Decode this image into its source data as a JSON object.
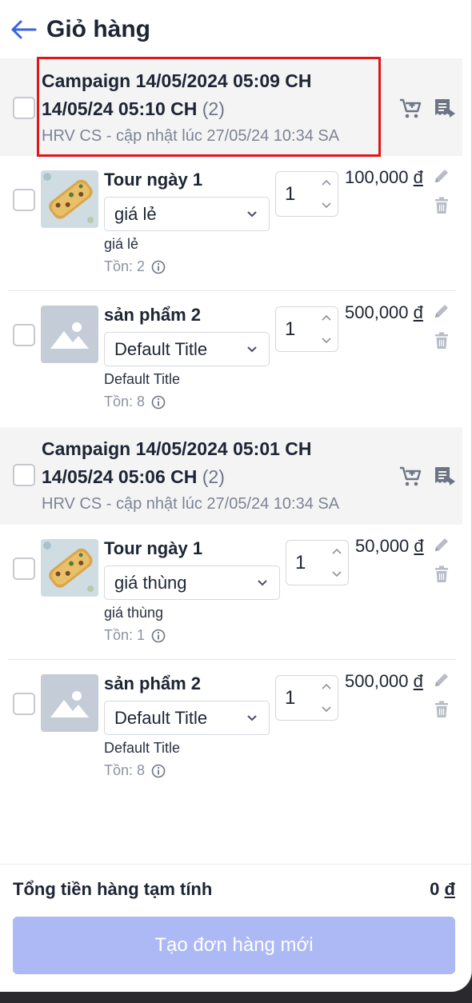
{
  "header": {
    "title": "Giỏ hàng"
  },
  "groups": [
    {
      "title_line1": "Campaign 14/05/2024 05:09 CH",
      "title_line2": "14/05/24 05:10 CH",
      "count": "(2)",
      "subtitle": "HRV CS - cập nhật lúc 27/05/24 10:34 SA",
      "items": [
        {
          "name": "Tour ngày 1",
          "variant_select": "giá lẻ",
          "variant_label": "giá lẻ",
          "stock": "Tồn: 2",
          "quantity": "1",
          "price": "100,000",
          "currency": "đ",
          "thumb": "food"
        },
        {
          "name": "sản phẩm 2",
          "variant_select": "Default Title",
          "variant_label": "Default Title",
          "stock": "Tồn: 8",
          "quantity": "1",
          "price": "500,000",
          "currency": "đ",
          "thumb": "placeholder"
        }
      ]
    },
    {
      "title_line1": "Campaign 14/05/2024 05:01 CH",
      "title_line2": "14/05/24 05:06 CH",
      "count": "(2)",
      "subtitle": "HRV CS - cập nhật lúc 27/05/24 10:34 SA",
      "items": [
        {
          "name": "Tour ngày 1",
          "variant_select": "giá thùng",
          "variant_label": "giá thùng",
          "stock": "Tồn: 1",
          "quantity": "1",
          "price": "50,000",
          "currency": "đ",
          "thumb": "food"
        },
        {
          "name": "sản phẩm 2",
          "variant_select": "Default Title",
          "variant_label": "Default Title",
          "stock": "Tồn: 8",
          "quantity": "1",
          "price": "500,000",
          "currency": "đ",
          "thumb": "placeholder"
        }
      ]
    }
  ],
  "footer": {
    "total_label": "Tổng tiền hàng tạm tính",
    "total_value": "0",
    "total_currency": "đ",
    "create_button": "Tạo đơn hàng mới"
  },
  "colors": {
    "accent": "#3a63e0",
    "highlight": "#e1161c",
    "button_disabled": "#adb9f5"
  }
}
